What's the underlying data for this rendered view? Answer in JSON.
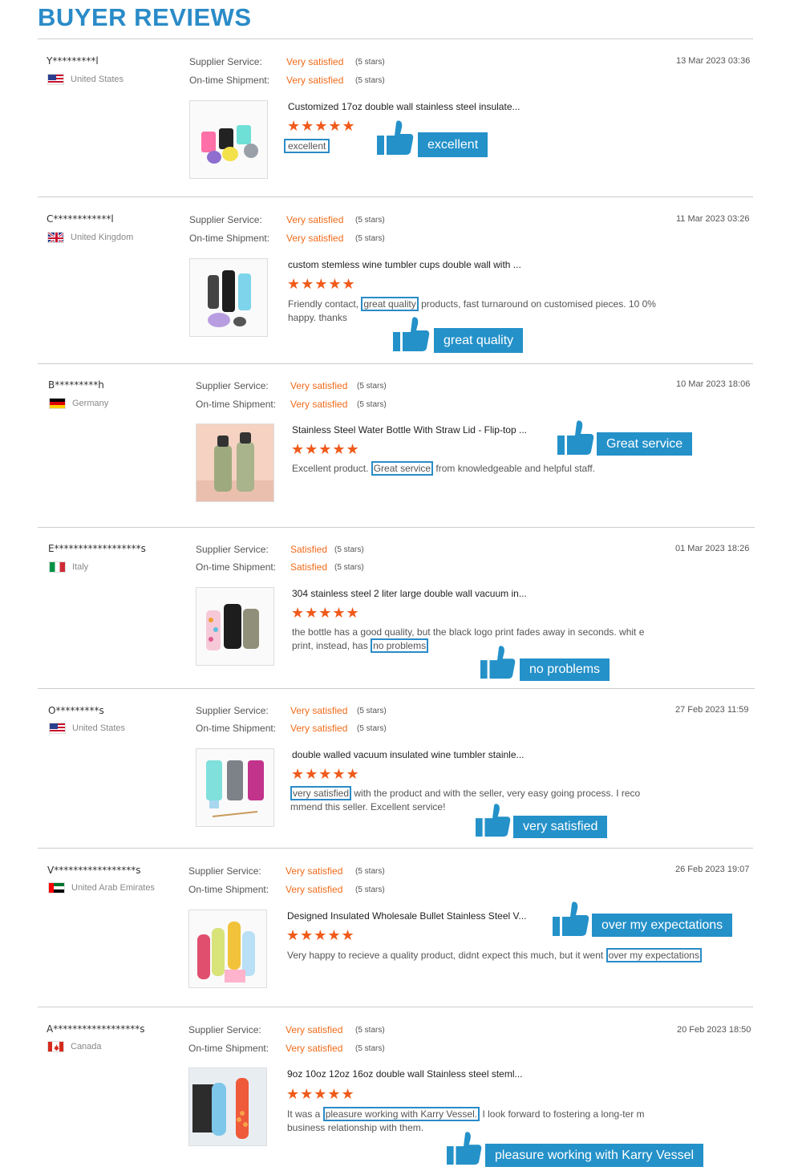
{
  "page": {
    "title": "BUYER REVIEWS"
  },
  "labels": {
    "supplier": "Supplier Service:",
    "shipment": "On-time Shipment:"
  },
  "colors": {
    "accent": "#2a8bc8",
    "rating": "#f06b1a"
  },
  "reviews": [
    {
      "buyer": "Y*********l",
      "country": "United States",
      "flag": "us",
      "supplier_rating": "Very satisfied",
      "supplier_stars": "(5 stars)",
      "shipment_rating": "Very satisfied",
      "shipment_stars": "(5 stars)",
      "date": "13 Mar 2023 03:36",
      "product": "Customized 17oz double wall stainless steel insulate...",
      "stars": "★★★★★",
      "stars_count": 5,
      "comment_pre": "",
      "comment_highlight": "excellent",
      "comment_post": "",
      "tag": "excellent",
      "thumb_icon": "thumbs-up-icon"
    },
    {
      "buyer": "C************l",
      "country": "United Kingdom",
      "flag": "uk",
      "supplier_rating": "Very satisfied",
      "supplier_stars": "(5 stars)",
      "shipment_rating": "Very satisfied",
      "shipment_stars": "(5 stars)",
      "date": "11 Mar 2023 03:26",
      "product": "custom stemless wine tumbler cups double wall with ...",
      "stars": "★★★★★",
      "stars_count": 5,
      "comment_pre": "Friendly contact, ",
      "comment_highlight": "great quality",
      "comment_post": " products, fast turnaround on customised pieces. 10 0% happy. thanks",
      "tag": "great quality",
      "thumb_icon": "thumbs-up-icon"
    },
    {
      "buyer": "B*********h",
      "country": "Germany",
      "flag": "de",
      "supplier_rating": "Very satisfied",
      "supplier_stars": "(5 stars)",
      "shipment_rating": "Very satisfied",
      "shipment_stars": "(5 stars)",
      "date": "10 Mar 2023 18:06",
      "product": "Stainless Steel Water Bottle With Straw Lid - Flip-top ...",
      "stars": "★★★★★",
      "stars_count": 5,
      "comment_pre": "Excellent product. ",
      "comment_highlight": "Great service",
      "comment_post": " from knowledgeable and helpful staff.",
      "tag": "Great service",
      "thumb_icon": "thumbs-up-icon"
    },
    {
      "buyer": "E******************s",
      "country": "Italy",
      "flag": "it",
      "supplier_rating": "Satisfied",
      "supplier_stars": "(5 stars)",
      "shipment_rating": "Satisfied",
      "shipment_stars": "(5 stars)",
      "date": "01 Mar 2023 18:26",
      "product": "304 stainless steel 2 liter large double wall vacuum in...",
      "stars": "★★★★★",
      "stars_count": 5,
      "comment_pre": "the bottle has a good quality, but the black logo print fades away in seconds. whit e print, instead, has ",
      "comment_highlight": "no problems",
      "comment_post": "",
      "tag": "no problems",
      "thumb_icon": "thumbs-up-icon"
    },
    {
      "buyer": "O*********s",
      "country": "United States",
      "flag": "us",
      "supplier_rating": "Very satisfied",
      "supplier_stars": "(5 stars)",
      "shipment_rating": "Very satisfied",
      "shipment_stars": "(5 stars)",
      "date": "27 Feb 2023 11:59",
      "product": "double walled vacuum insulated wine tumbler stainle...",
      "stars": "★★★★★",
      "stars_count": 5,
      "comment_pre": "",
      "comment_highlight": "very satisfied",
      "comment_post": " with the product and with the seller, very easy going process. I reco mmend this seller. Excellent service!",
      "tag": "very satisfied",
      "thumb_icon": "thumbs-up-icon"
    },
    {
      "buyer": "V*****************s",
      "country": "United Arab Emirates",
      "flag": "ae",
      "supplier_rating": "Very satisfied",
      "supplier_stars": "(5 stars)",
      "shipment_rating": "Very satisfied",
      "shipment_stars": "(5 stars)",
      "date": "26 Feb 2023 19:07",
      "product": "Designed Insulated Wholesale Bullet Stainless Steel V...",
      "stars": "★★★★★",
      "stars_count": 5,
      "comment_pre": "Very happy to recieve a quality product, didnt expect this much, but it went ",
      "comment_highlight": "over my expectations",
      "comment_post": "",
      "tag": "over my expectations",
      "thumb_icon": "thumbs-up-icon"
    },
    {
      "buyer": "A******************s",
      "country": "Canada",
      "flag": "ca",
      "supplier_rating": "Very satisfied",
      "supplier_stars": "(5 stars)",
      "shipment_rating": "Very satisfied",
      "shipment_stars": "(5 stars)",
      "date": "20 Feb 2023 18:50",
      "product": "9oz 10oz 12oz 16oz double wall Stainless steel steml...",
      "stars": "★★★★★",
      "stars_count": 5,
      "comment_pre": "It was a ",
      "comment_highlight": "pleasure working with Karry Vessel.",
      "comment_post": " I look forward to fostering a long-ter m business relationship with them.",
      "tag": "pleasure working with Karry Vessel",
      "thumb_icon": "thumbs-up-icon"
    }
  ]
}
